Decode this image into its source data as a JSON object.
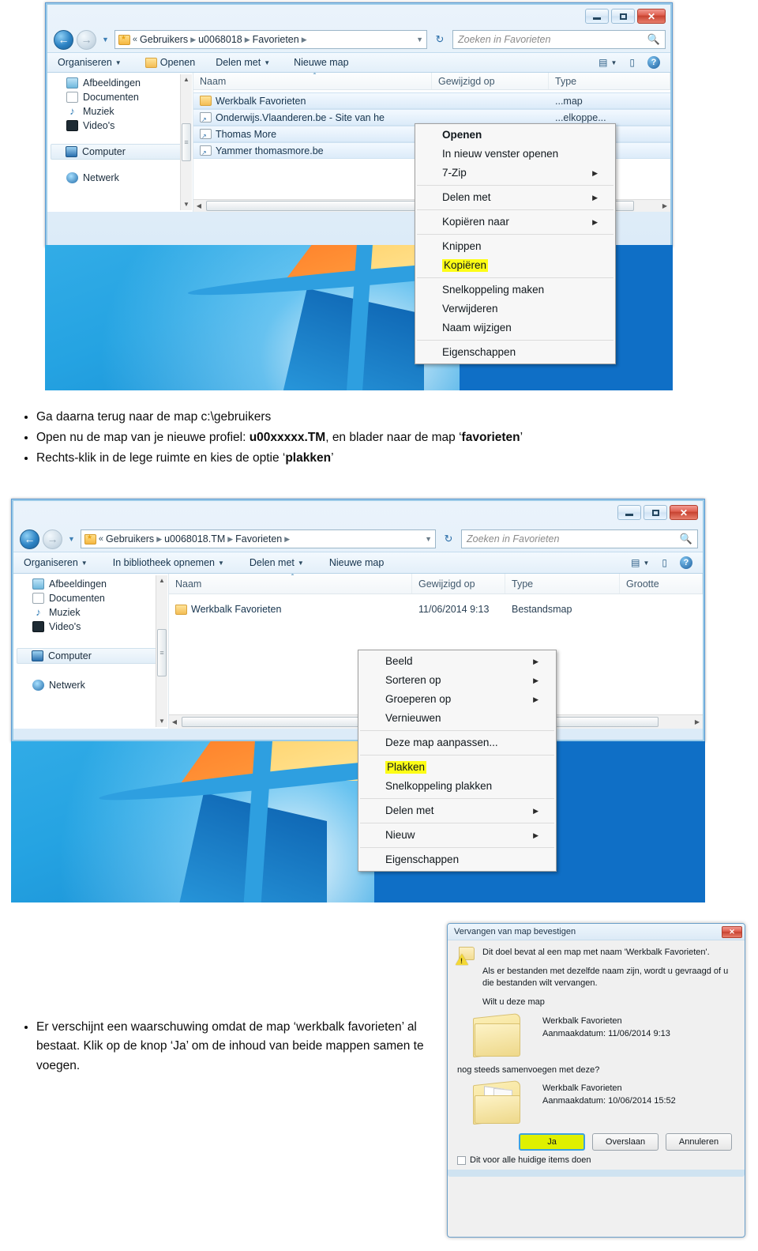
{
  "document": {
    "instructions_top": [
      {
        "parts": [
          {
            "t": "Ga daarna terug naar de map c:\\gebruikers",
            "b": false
          }
        ]
      },
      {
        "parts": [
          {
            "t": "Open nu de map van je nieuwe profiel: ",
            "b": false
          },
          {
            "t": "u00xxxxx.TM",
            "b": true
          },
          {
            "t": ", en blader naar de map ‘",
            "b": false
          },
          {
            "t": "favorieten",
            "b": true
          },
          {
            "t": "’",
            "b": false
          }
        ]
      },
      {
        "parts": [
          {
            "t": "Rechts-klik in de lege ruimte en kies de optie ‘",
            "b": false
          },
          {
            "t": "plakken",
            "b": true
          },
          {
            "t": "’",
            "b": false
          }
        ]
      }
    ],
    "instructions_bottom": [
      {
        "parts": [
          {
            "t": "Er verschijnt een waarschuwing omdat de map ‘werkbalk favorieten’ al bestaat. Klik op de knop ‘Ja’ om de inhoud van beide mappen samen te voegen.",
            "b": false
          }
        ]
      }
    ]
  },
  "window1": {
    "nav": {
      "back_icon": "back-arrow-icon",
      "forward_icon": "forward-arrow-icon",
      "dropdown_icon": "chevron-down-icon"
    },
    "breadcrumb": {
      "double_chevron": "«",
      "items": [
        "Gebruikers",
        "u0068018",
        "Favorieten"
      ]
    },
    "address_dropdown_icon": "chevron-down-icon",
    "refresh_icon": "refresh-icon",
    "search": {
      "placeholder": "Zoeken in Favorieten",
      "icon": "search-icon"
    },
    "titlebar": {
      "minimize": "minimize-icon",
      "maximize": "maximize-icon",
      "close": "✕"
    },
    "toolbar": {
      "items": [
        "Organiseren",
        "Openen",
        "Delen met",
        "Nieuwe map"
      ],
      "view_icon": "view-list-icon",
      "preview_icon": "preview-pane-icon",
      "help_icon": "?"
    },
    "sidebar": {
      "items": [
        {
          "label": "Afbeeldingen",
          "icon": "pictures-icon",
          "selected": false
        },
        {
          "label": "Documenten",
          "icon": "documents-icon",
          "selected": false
        },
        {
          "label": "Muziek",
          "icon": "music-icon",
          "selected": false
        },
        {
          "label": "Video's",
          "icon": "video-icon",
          "selected": false
        },
        {
          "label": "Computer",
          "icon": "computer-icon",
          "selected": true
        },
        {
          "label": "Netwerk",
          "icon": "network-icon",
          "selected": false
        }
      ]
    },
    "columns": [
      "Naam",
      "Gewijzigd op",
      "Type"
    ],
    "rows": [
      {
        "name": "Werkbalk Favorieten",
        "icon": "folder-icon",
        "type": "...map"
      },
      {
        "name": "Onderwijs.Vlaanderen.be - Site van he",
        "icon": "shortcut-icon",
        "type": "...elkoppe..."
      },
      {
        "name": "Thomas More",
        "icon": "shortcut-icon",
        "type": "...elkoppe..."
      },
      {
        "name": "Yammer  thomasmore.be",
        "icon": "shortcut-icon",
        "type": "...elkoppe..."
      }
    ],
    "context_menu": {
      "items": [
        {
          "label": "Openen",
          "bold": true,
          "submenu": false,
          "highlight": false
        },
        {
          "label": "In nieuw venster openen",
          "bold": false,
          "submenu": false,
          "highlight": false
        },
        {
          "label": "7-Zip",
          "bold": false,
          "submenu": true,
          "highlight": false
        },
        {
          "separator": true
        },
        {
          "label": "Delen met",
          "bold": false,
          "submenu": true,
          "highlight": false
        },
        {
          "separator": true
        },
        {
          "label": "Kopiëren naar",
          "bold": false,
          "submenu": true,
          "highlight": false
        },
        {
          "separator": true
        },
        {
          "label": "Knippen",
          "bold": false,
          "submenu": false,
          "highlight": false
        },
        {
          "label": "Kopiëren",
          "bold": false,
          "submenu": false,
          "highlight": true
        },
        {
          "separator": true
        },
        {
          "label": "Snelkoppeling maken",
          "bold": false,
          "submenu": false,
          "highlight": false
        },
        {
          "label": "Verwijderen",
          "bold": false,
          "submenu": false,
          "highlight": false
        },
        {
          "label": "Naam wijzigen",
          "bold": false,
          "submenu": false,
          "highlight": false
        },
        {
          "separator": true
        },
        {
          "label": "Eigenschappen",
          "bold": false,
          "submenu": false,
          "highlight": false
        }
      ]
    }
  },
  "window2": {
    "breadcrumb": {
      "double_chevron": "«",
      "items": [
        "Gebruikers",
        "u0068018.TM",
        "Favorieten"
      ]
    },
    "search": {
      "placeholder": "Zoeken in Favorieten",
      "icon": "search-icon"
    },
    "titlebar": {
      "minimize": "minimize-icon",
      "maximize": "maximize-icon",
      "close": "✕"
    },
    "toolbar": {
      "items": [
        "Organiseren",
        "In bibliotheek opnemen",
        "Delen met",
        "Nieuwe map"
      ],
      "view_icon": "view-list-icon",
      "preview_icon": "preview-pane-icon",
      "help_icon": "?"
    },
    "sidebar": {
      "items": [
        {
          "label": "Afbeeldingen",
          "icon": "pictures-icon",
          "selected": false
        },
        {
          "label": "Documenten",
          "icon": "documents-icon",
          "selected": false
        },
        {
          "label": "Muziek",
          "icon": "music-icon",
          "selected": false
        },
        {
          "label": "Video's",
          "icon": "video-icon",
          "selected": false
        },
        {
          "label": "Computer",
          "icon": "computer-icon",
          "selected": true
        },
        {
          "label": "Netwerk",
          "icon": "network-icon",
          "selected": false
        }
      ]
    },
    "columns": [
      "Naam",
      "Gewijzigd op",
      "Type",
      "Grootte"
    ],
    "rows": [
      {
        "name": "Werkbalk Favorieten",
        "icon": "folder-icon",
        "modified": "11/06/2014 9:13",
        "type": "Bestandsmap",
        "size": ""
      }
    ],
    "context_menu": {
      "items": [
        {
          "label": "Beeld",
          "submenu": true,
          "highlight": false
        },
        {
          "label": "Sorteren op",
          "submenu": true,
          "highlight": false
        },
        {
          "label": "Groeperen op",
          "submenu": true,
          "highlight": false
        },
        {
          "label": "Vernieuwen",
          "submenu": false,
          "highlight": false
        },
        {
          "separator": true
        },
        {
          "label": "Deze map aanpassen...",
          "submenu": false,
          "highlight": false
        },
        {
          "separator": true
        },
        {
          "label": "Plakken",
          "submenu": false,
          "highlight": true
        },
        {
          "label": "Snelkoppeling plakken",
          "submenu": false,
          "highlight": false
        },
        {
          "separator": true
        },
        {
          "label": "Delen met",
          "submenu": true,
          "highlight": false
        },
        {
          "separator": true
        },
        {
          "label": "Nieuw",
          "submenu": true,
          "highlight": false
        },
        {
          "separator": true
        },
        {
          "label": "Eigenschappen",
          "submenu": false,
          "highlight": false
        }
      ]
    }
  },
  "dialog": {
    "title": "Vervangen van map bevestigen",
    "close_label": "✕",
    "warning_icon": "warning-folder-icon",
    "line1": "Dit doel bevat al een map met naam 'Werkbalk Favorieten'.",
    "line2": "Als er bestanden met dezelfde naam zijn, wordt u gevraagd of u die bestanden wilt vervangen.",
    "line3": "Wilt u deze map",
    "item1": {
      "name": "Werkbalk Favorieten",
      "meta": "Aanmaakdatum: 11/06/2014 9:13",
      "icon": "folder-closed-icon"
    },
    "line4": "nog steeds samenvoegen met deze?",
    "item2": {
      "name": "Werkbalk Favorieten",
      "meta": "Aanmaakdatum: 10/06/2014 15:52",
      "icon": "folder-open-icon"
    },
    "buttons": [
      {
        "label": "Ja",
        "primary": true
      },
      {
        "label": "Overslaan",
        "primary": false
      },
      {
        "label": "Annuleren",
        "primary": false
      }
    ],
    "checkbox": {
      "label": "Dit voor alle huidige items doen",
      "checked": false
    }
  },
  "colors": {
    "highlight_yellow": "#fdfd16",
    "primary_button": "#dff000",
    "accent_blue": "#2e9fe0",
    "close_red": "#c5402e"
  }
}
